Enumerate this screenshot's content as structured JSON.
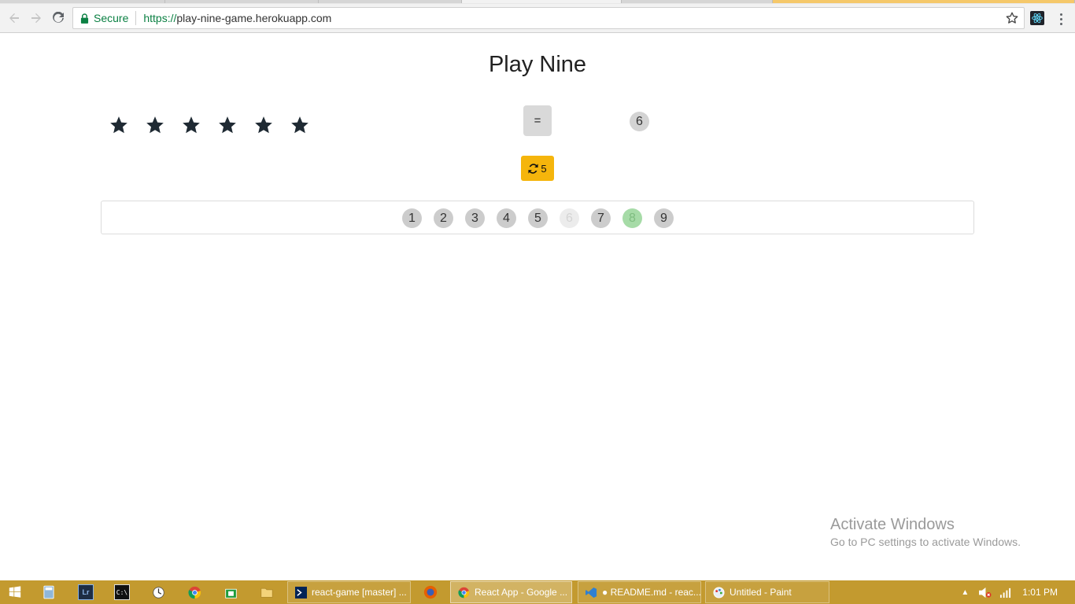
{
  "browser": {
    "security_label": "Secure",
    "url_scheme": "https://",
    "url_host": "play-nine-game.herokuapp.com"
  },
  "game": {
    "title": "Play Nine",
    "stars_count": 6,
    "star_icon": "star-icon",
    "check_button_label": "=",
    "answer_numbers": [
      "6"
    ],
    "redraws_left": "5",
    "redraw_icon": "refresh-icon",
    "numbers": [
      {
        "label": "1",
        "state": "available"
      },
      {
        "label": "2",
        "state": "available"
      },
      {
        "label": "3",
        "state": "available"
      },
      {
        "label": "4",
        "state": "available"
      },
      {
        "label": "5",
        "state": "available"
      },
      {
        "label": "6",
        "state": "used"
      },
      {
        "label": "7",
        "state": "available"
      },
      {
        "label": "8",
        "state": "selected"
      },
      {
        "label": "9",
        "state": "available"
      }
    ],
    "colors": {
      "redraw_button": "#f5b50c",
      "number_default": "#cccccc",
      "number_selected": "#a6dba7",
      "number_used": "#ececec"
    }
  },
  "watermark": {
    "line1": "Activate Windows",
    "line2": "Go to PC settings to activate Windows."
  },
  "taskbar": {
    "apps": [
      {
        "label": "react-game [master] ..."
      },
      {
        "label": "React App - Google ..."
      },
      {
        "label": "● README.md - reac..."
      },
      {
        "label": "Untitled - Paint"
      }
    ],
    "clock": "1:01 PM"
  }
}
